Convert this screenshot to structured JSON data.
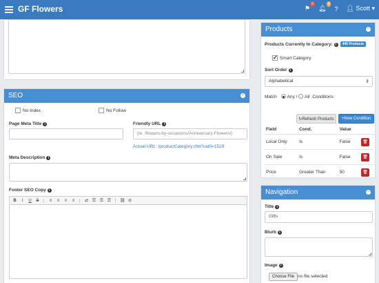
{
  "app": {
    "title": "GF Flowers"
  },
  "topbar": {
    "flag_badge": "0",
    "bell_badge": "0",
    "help": "?",
    "user": "Scott",
    "user_caret": "▾"
  },
  "seo": {
    "header": "SEO",
    "no_index": "No Index",
    "no_follow": "No Follow",
    "meta_title_label": "Page Meta Title",
    "friendly_url_label": "Friendly URL",
    "friendly_url_placeholder": "(ie. /flowers-by-occasions/Anniversary-Flowers/)",
    "actual_url_prefix": "Actual URL:",
    "actual_url": "/productCategory.cfm?cat0=1529",
    "meta_description_label": "Meta Description",
    "footer_copy_label": "Footer SEO Copy",
    "toolbar": [
      "B",
      "I",
      "U",
      "S",
      "≡",
      "≡",
      "≡",
      "≡",
      "⇄",
      "☰",
      "☰",
      "☰",
      "⛓",
      "⊘"
    ]
  },
  "products": {
    "header": "Products",
    "count_label": "Products Currently In Category:",
    "count_badge": "440 Products",
    "smart_category": "Smart Category",
    "sort_order_label": "Sort Order",
    "sort_order_value": "Alphabetical",
    "match_label": "Match",
    "match_any": "Any",
    "match_sep": "/",
    "match_all": "All",
    "match_suffix": "Conditions",
    "refresh_button": "Refresh Products",
    "new_condition_button": "New Condition",
    "columns": [
      "Field",
      "Cond.",
      "Value"
    ],
    "rows": [
      {
        "field": "Local Only",
        "cond": "Is",
        "value": "False"
      },
      {
        "field": "On Sale",
        "cond": "Is",
        "value": "False"
      },
      {
        "field": "Price",
        "cond": "Greater Than",
        "value": "50"
      }
    ]
  },
  "navigation": {
    "header": "Navigation",
    "title_label": "Title",
    "title_value": "Gifts",
    "blurb_label": "Blurb",
    "image_label": "Image",
    "choose_file": "Choose File",
    "no_file": "no file selected"
  },
  "colors": {
    "primary": "#3a7bc0",
    "panel_header": "#4a8ed2",
    "danger": "#b52b2b",
    "background": "#e9ebee"
  }
}
